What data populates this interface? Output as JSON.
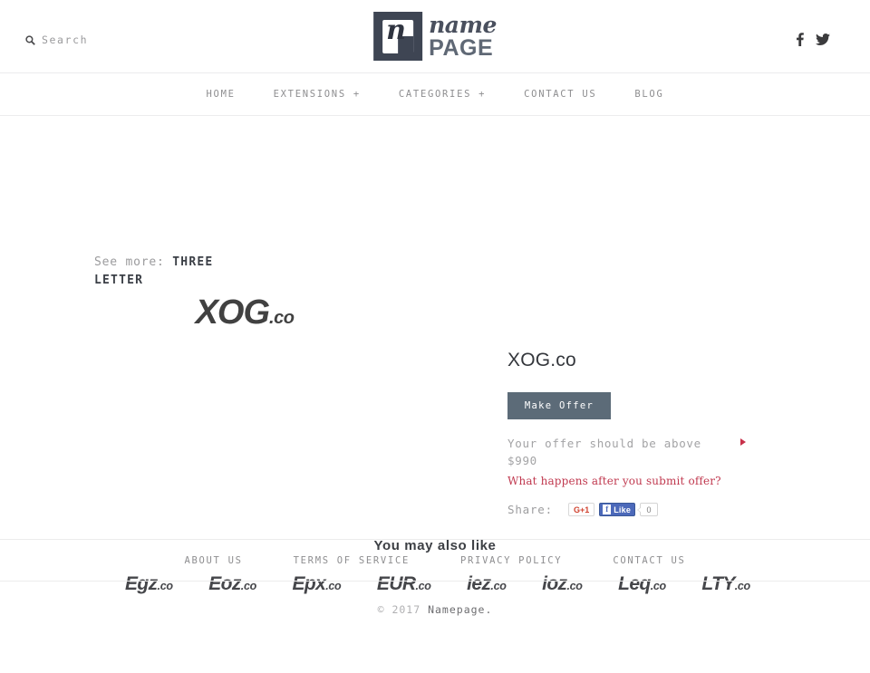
{
  "header": {
    "search": {
      "label": "Search",
      "icon": "search-icon"
    },
    "logo": {
      "mark_letter": "n",
      "name": "name",
      "page": "PAGE"
    },
    "social": [
      {
        "name": "facebook-icon",
        "title": "Facebook"
      },
      {
        "name": "twitter-icon",
        "title": "Twitter"
      }
    ]
  },
  "nav": {
    "items": [
      {
        "label": "HOME"
      },
      {
        "label": "EXTENSIONS +"
      },
      {
        "label": "CATEGORIES +"
      },
      {
        "label": "CONTACT US"
      },
      {
        "label": "BLOG"
      }
    ]
  },
  "breadcrumb": {
    "prefix": "See more:",
    "category": "THREE LETTER"
  },
  "domain": {
    "art_name": "XOG",
    "art_tld": ".co",
    "title": "XOG.co",
    "button_label": "Make Offer",
    "offer_note": "Your offer should be above $990",
    "minimum_price": "$990",
    "help_link": "What happens after you submit offer?",
    "share_label": "Share:",
    "gplus_label": "G+1",
    "facebook_like_label": "Like",
    "facebook_f": "f",
    "facebook_count": "0"
  },
  "also_like": {
    "title": "You may also like",
    "items": [
      {
        "name": "Egz",
        "tld": ".co"
      },
      {
        "name": "Eoz",
        "tld": ".co"
      },
      {
        "name": "Epx",
        "tld": ".co"
      },
      {
        "name": "EUR",
        "tld": ".co"
      },
      {
        "name": "iez",
        "tld": ".co"
      },
      {
        "name": "ioz",
        "tld": ".co"
      },
      {
        "name": "Leq",
        "tld": ".co"
      },
      {
        "name": "LTY",
        "tld": ".co"
      }
    ]
  },
  "footer": {
    "links": [
      {
        "label": "ABOUT US"
      },
      {
        "label": "TERMS OF SERVICE"
      },
      {
        "label": "PRIVACY POLICY"
      },
      {
        "label": "CONTACT US"
      }
    ],
    "copyright_year": "© 2017",
    "copyright_name": "Namepage."
  },
  "colors": {
    "button": "#5c6b78",
    "accent_red": "#c0394f",
    "logo_dark": "#3e4553",
    "facebook_blue": "#4c69ba",
    "gplus_red": "#d0422f"
  }
}
